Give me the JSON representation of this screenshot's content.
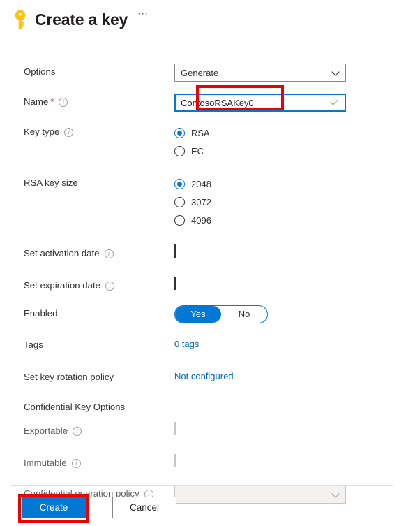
{
  "header": {
    "icon": "key-icon",
    "title": "Create a key",
    "more_label": "⋯"
  },
  "form": {
    "options": {
      "label": "Options",
      "value": "Generate",
      "chevron": "chevron-down-icon"
    },
    "name": {
      "label": "Name",
      "required_mark": "*",
      "info": "i",
      "value": "ContosoRSAKey0",
      "validation": "valid-checkmark"
    },
    "key_type": {
      "label": "Key type",
      "info": "i",
      "options": [
        {
          "label": "RSA",
          "selected": true
        },
        {
          "label": "EC",
          "selected": false
        }
      ]
    },
    "rsa_key_size": {
      "label": "RSA key size",
      "options": [
        {
          "label": "2048",
          "selected": true
        },
        {
          "label": "3072",
          "selected": false
        },
        {
          "label": "4096",
          "selected": false
        }
      ]
    },
    "set_activation_date": {
      "label": "Set activation date",
      "info": "i",
      "checked": false
    },
    "set_expiration_date": {
      "label": "Set expiration date",
      "info": "i",
      "checked": false
    },
    "enabled": {
      "label": "Enabled",
      "yes_label": "Yes",
      "no_label": "No",
      "value": "Yes"
    },
    "tags": {
      "label": "Tags",
      "value": "0 tags"
    },
    "rotation_policy": {
      "label": "Set key rotation policy",
      "value": "Not configured"
    },
    "confidential_section": {
      "heading": "Confidential Key Options",
      "exportable": {
        "label": "Exportable",
        "info": "i",
        "checked": false,
        "disabled": true
      },
      "immutable": {
        "label": "Immutable",
        "info": "i",
        "checked": false,
        "disabled": true
      },
      "confidential_operation_policy": {
        "label": "Confidential operation policy",
        "info": "i",
        "value": "",
        "disabled": true,
        "chevron": "chevron-down-icon"
      }
    }
  },
  "footer": {
    "create_label": "Create",
    "cancel_label": "Cancel"
  },
  "colors": {
    "accent": "#0078d4",
    "link": "#0067b8",
    "annotation": "#ed0000",
    "valid": "#6bb700",
    "key_icon": "#ffc20e"
  }
}
